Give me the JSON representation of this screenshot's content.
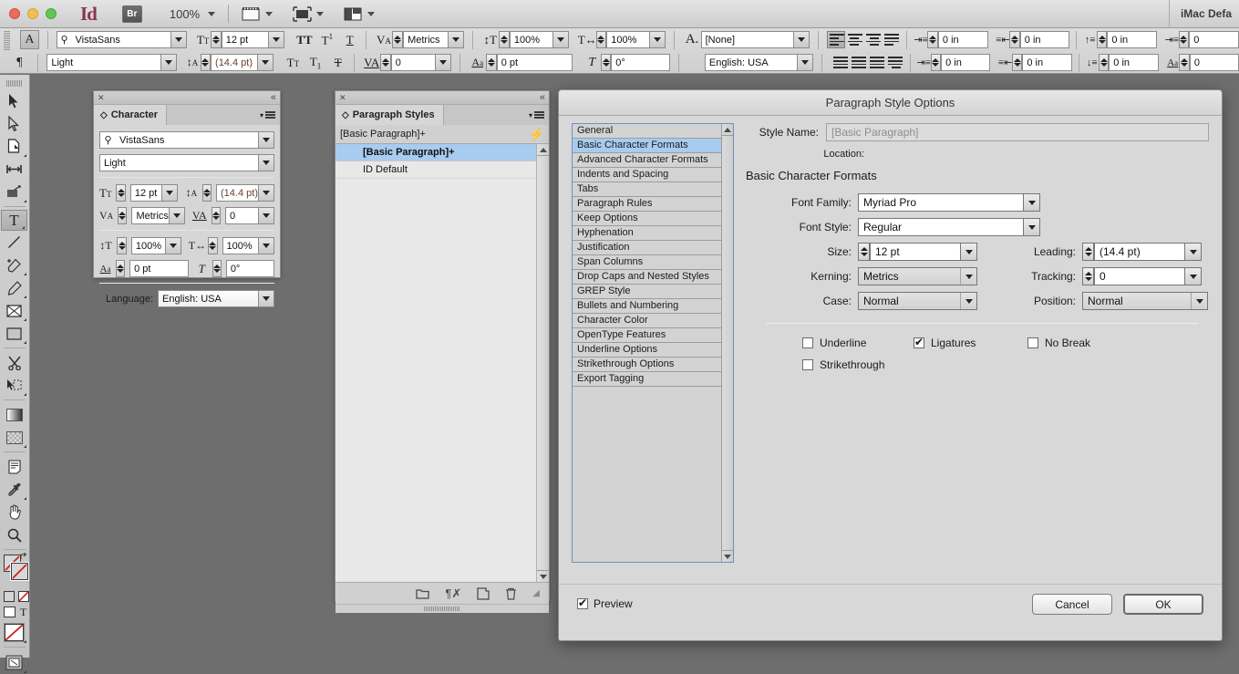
{
  "titlebar": {
    "app_logo": "Id",
    "bridge_label": "Br",
    "zoom_level": "100%",
    "workspace": "iMac Defa"
  },
  "control_panel": {
    "font_family": "VistaSans",
    "font_style": "Light",
    "size": "12 pt",
    "leading": "(14.4 pt)",
    "kerning": "Metrics",
    "tracking": "0",
    "vertical_scale": "100%",
    "horizontal_scale": "100%",
    "baseline_shift": "0 pt",
    "skew": "0°",
    "character_style": "[None]",
    "language": "English: USA",
    "left_indent": "0 in",
    "first_line_indent": "0 in",
    "right_indent": "0 in",
    "last_line_indent": "0 in",
    "space_before": "0 in",
    "space_after": "0 in",
    "drop_cap_lines": "0",
    "drop_cap_chars": "0"
  },
  "character_panel": {
    "title": "Character",
    "font_family": "VistaSans",
    "font_style": "Light",
    "size": "12 pt",
    "leading": "(14.4 pt)",
    "kerning": "Metrics",
    "tracking": "0",
    "vertical_scale": "100%",
    "horizontal_scale": "100%",
    "baseline_shift": "0 pt",
    "skew": "0°",
    "language_label": "Language:",
    "language": "English: USA"
  },
  "paragraph_styles_panel": {
    "title": "Paragraph Styles",
    "current_style": "[Basic Paragraph]+",
    "items": [
      {
        "label": "[Basic Paragraph]+",
        "selected": true
      },
      {
        "label": "ID Default",
        "selected": false
      }
    ]
  },
  "dialog": {
    "title": "Paragraph Style Options",
    "categories": [
      "General",
      "Basic Character Formats",
      "Advanced Character Formats",
      "Indents and Spacing",
      "Tabs",
      "Paragraph Rules",
      "Keep Options",
      "Hyphenation",
      "Justification",
      "Span Columns",
      "Drop Caps and Nested Styles",
      "GREP Style",
      "Bullets and Numbering",
      "Character Color",
      "OpenType Features",
      "Underline Options",
      "Strikethrough Options",
      "Export Tagging"
    ],
    "selected_category": "Basic Character Formats",
    "style_name_label": "Style Name:",
    "style_name_value": "[Basic Paragraph]",
    "location_label": "Location:",
    "location_value": "",
    "section_heading": "Basic Character Formats",
    "fields": {
      "font_family_label": "Font Family:",
      "font_family_value": "Myriad Pro",
      "font_style_label": "Font Style:",
      "font_style_value": "Regular",
      "size_label": "Size:",
      "size_value": "12 pt",
      "leading_label": "Leading:",
      "leading_value": "(14.4 pt)",
      "kerning_label": "Kerning:",
      "kerning_value": "Metrics",
      "tracking_label": "Tracking:",
      "tracking_value": "0",
      "case_label": "Case:",
      "case_value": "Normal",
      "position_label": "Position:",
      "position_value": "Normal"
    },
    "checkboxes": [
      {
        "label": "Underline",
        "checked": false
      },
      {
        "label": "Ligatures",
        "checked": true
      },
      {
        "label": "No Break",
        "checked": false
      },
      {
        "label": "Strikethrough",
        "checked": false
      }
    ],
    "preview_label": "Preview",
    "preview_checked": true,
    "cancel_label": "Cancel",
    "ok_label": "OK"
  },
  "colors": {
    "selection_blue": "#a8cbf0",
    "dialog_bg": "#d8d8d8",
    "panel_bg": "#d6d6d6",
    "canvas_bg": "#6e6e6e",
    "auto_leading": "#6b3f28"
  }
}
